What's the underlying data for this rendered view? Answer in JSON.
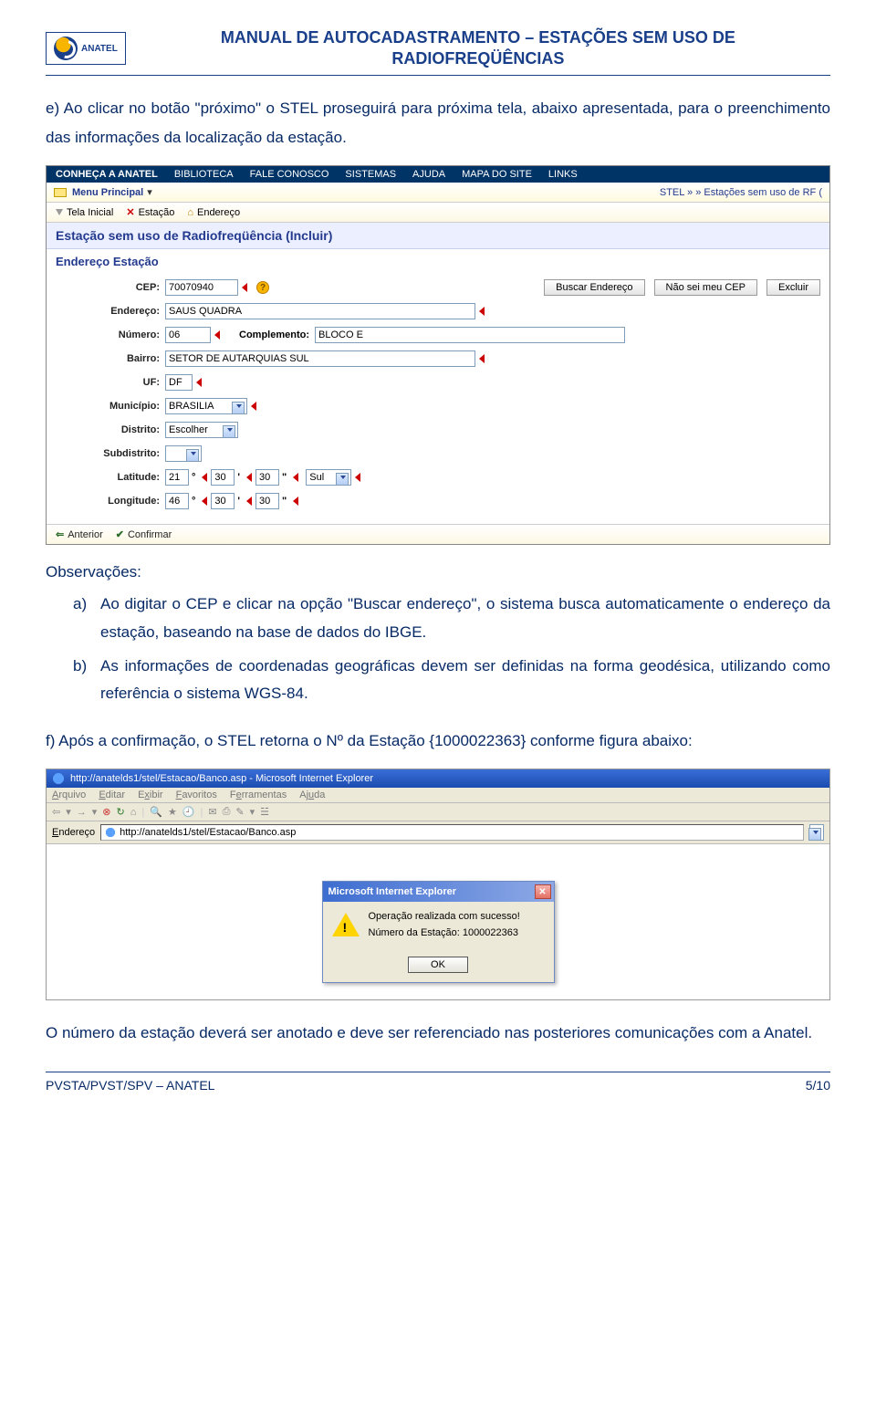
{
  "header": {
    "logo_label": "ANATEL",
    "title_l1": "MANUAL DE AUTOCADASTRAMENTO – ESTAÇÕES SEM USO DE",
    "title_l2": "RADIOFREQÜÊNCIAS"
  },
  "para_e": "e)  Ao clicar no botão \"próximo\" o STEL proseguirá para próxima tela, abaixo apresentada, para o preenchimento das informações da localização da estação.",
  "ss1": {
    "nav": [
      "CONHEÇA A ANATEL",
      "BIBLIOTECA",
      "FALE CONOSCO",
      "SISTEMAS",
      "AJUDA",
      "MAPA DO SITE",
      "LINKS"
    ],
    "menu_label": "Menu Principal",
    "breadcrumb": "STEL » » Estações sem uso de RF (",
    "toolbar": {
      "tela_inicial": "Tela Inicial",
      "estacao": "Estação",
      "endereco": "Endereço"
    },
    "section_title": "Estação sem uso de Radiofreqüência (Incluir)",
    "section_sub": "Endereço Estação",
    "labels": {
      "cep": "CEP:",
      "endereco": "Endereço:",
      "numero": "Número:",
      "complemento": "Complemento:",
      "bairro": "Bairro:",
      "uf": "UF:",
      "municipio": "Município:",
      "distrito": "Distrito:",
      "subdistrito": "Subdistrito:",
      "latitude": "Latitude:",
      "longitude": "Longitude:"
    },
    "values": {
      "cep": "70070940",
      "endereco": "SAUS QUADRA",
      "numero": "06",
      "complemento": "BLOCO E",
      "bairro": "SETOR DE AUTARQUIAS SUL",
      "uf": "DF",
      "municipio": "BRASILIA",
      "distrito": "Escolher",
      "subdistrito": "",
      "lat_deg": "21",
      "lat_min": "30",
      "lat_sec": "30",
      "lat_hemi": "Sul",
      "lon_deg": "46",
      "lon_min": "30",
      "lon_sec": "30"
    },
    "buttons": {
      "buscar": "Buscar Endereço",
      "nao_sei": "Não sei meu CEP",
      "excluir": "Excluir"
    },
    "footer": {
      "anterior": "Anterior",
      "confirmar": "Confirmar"
    },
    "deg": "°",
    "min": "'",
    "sec": "\""
  },
  "obs_title": "Observações:",
  "obs_a": "Ao digitar o CEP e clicar na opção \"Buscar endereço\", o sistema busca automaticamente o endereço da estação, baseando na base de dados do IBGE.",
  "obs_b": "As informações de coordenadas geográficas devem ser definidas na forma geodésica, utilizando como referência o sistema WGS-84.",
  "para_f": "f)  Após a confirmação, o STEL retorna o Nº da Estação {1000022363} conforme figura abaixo:",
  "ss2": {
    "title": "http://anatelds1/stel/Estacao/Banco.asp - Microsoft Internet Explorer",
    "menu": {
      "arquivo": "Arquivo",
      "editar": "Editar",
      "exibir": "Exibir",
      "favoritos": "Favoritos",
      "ferramentas": "Ferramentas",
      "ajuda": "Ajuda"
    },
    "addr_label": "Endereço",
    "url": "http://anatelds1/stel/Estacao/Banco.asp",
    "dialog_title": "Microsoft Internet Explorer",
    "dialog_l1": "Operação realizada com sucesso!",
    "dialog_l2": "Número da Estação: 1000022363",
    "ok": "OK"
  },
  "para_end": "O número da estação deverá ser anotado e deve ser referenciado nas posteriores comunicações com a Anatel.",
  "footer": {
    "left": "PVSTA/PVST/SPV – ANATEL",
    "right": "5/10"
  }
}
